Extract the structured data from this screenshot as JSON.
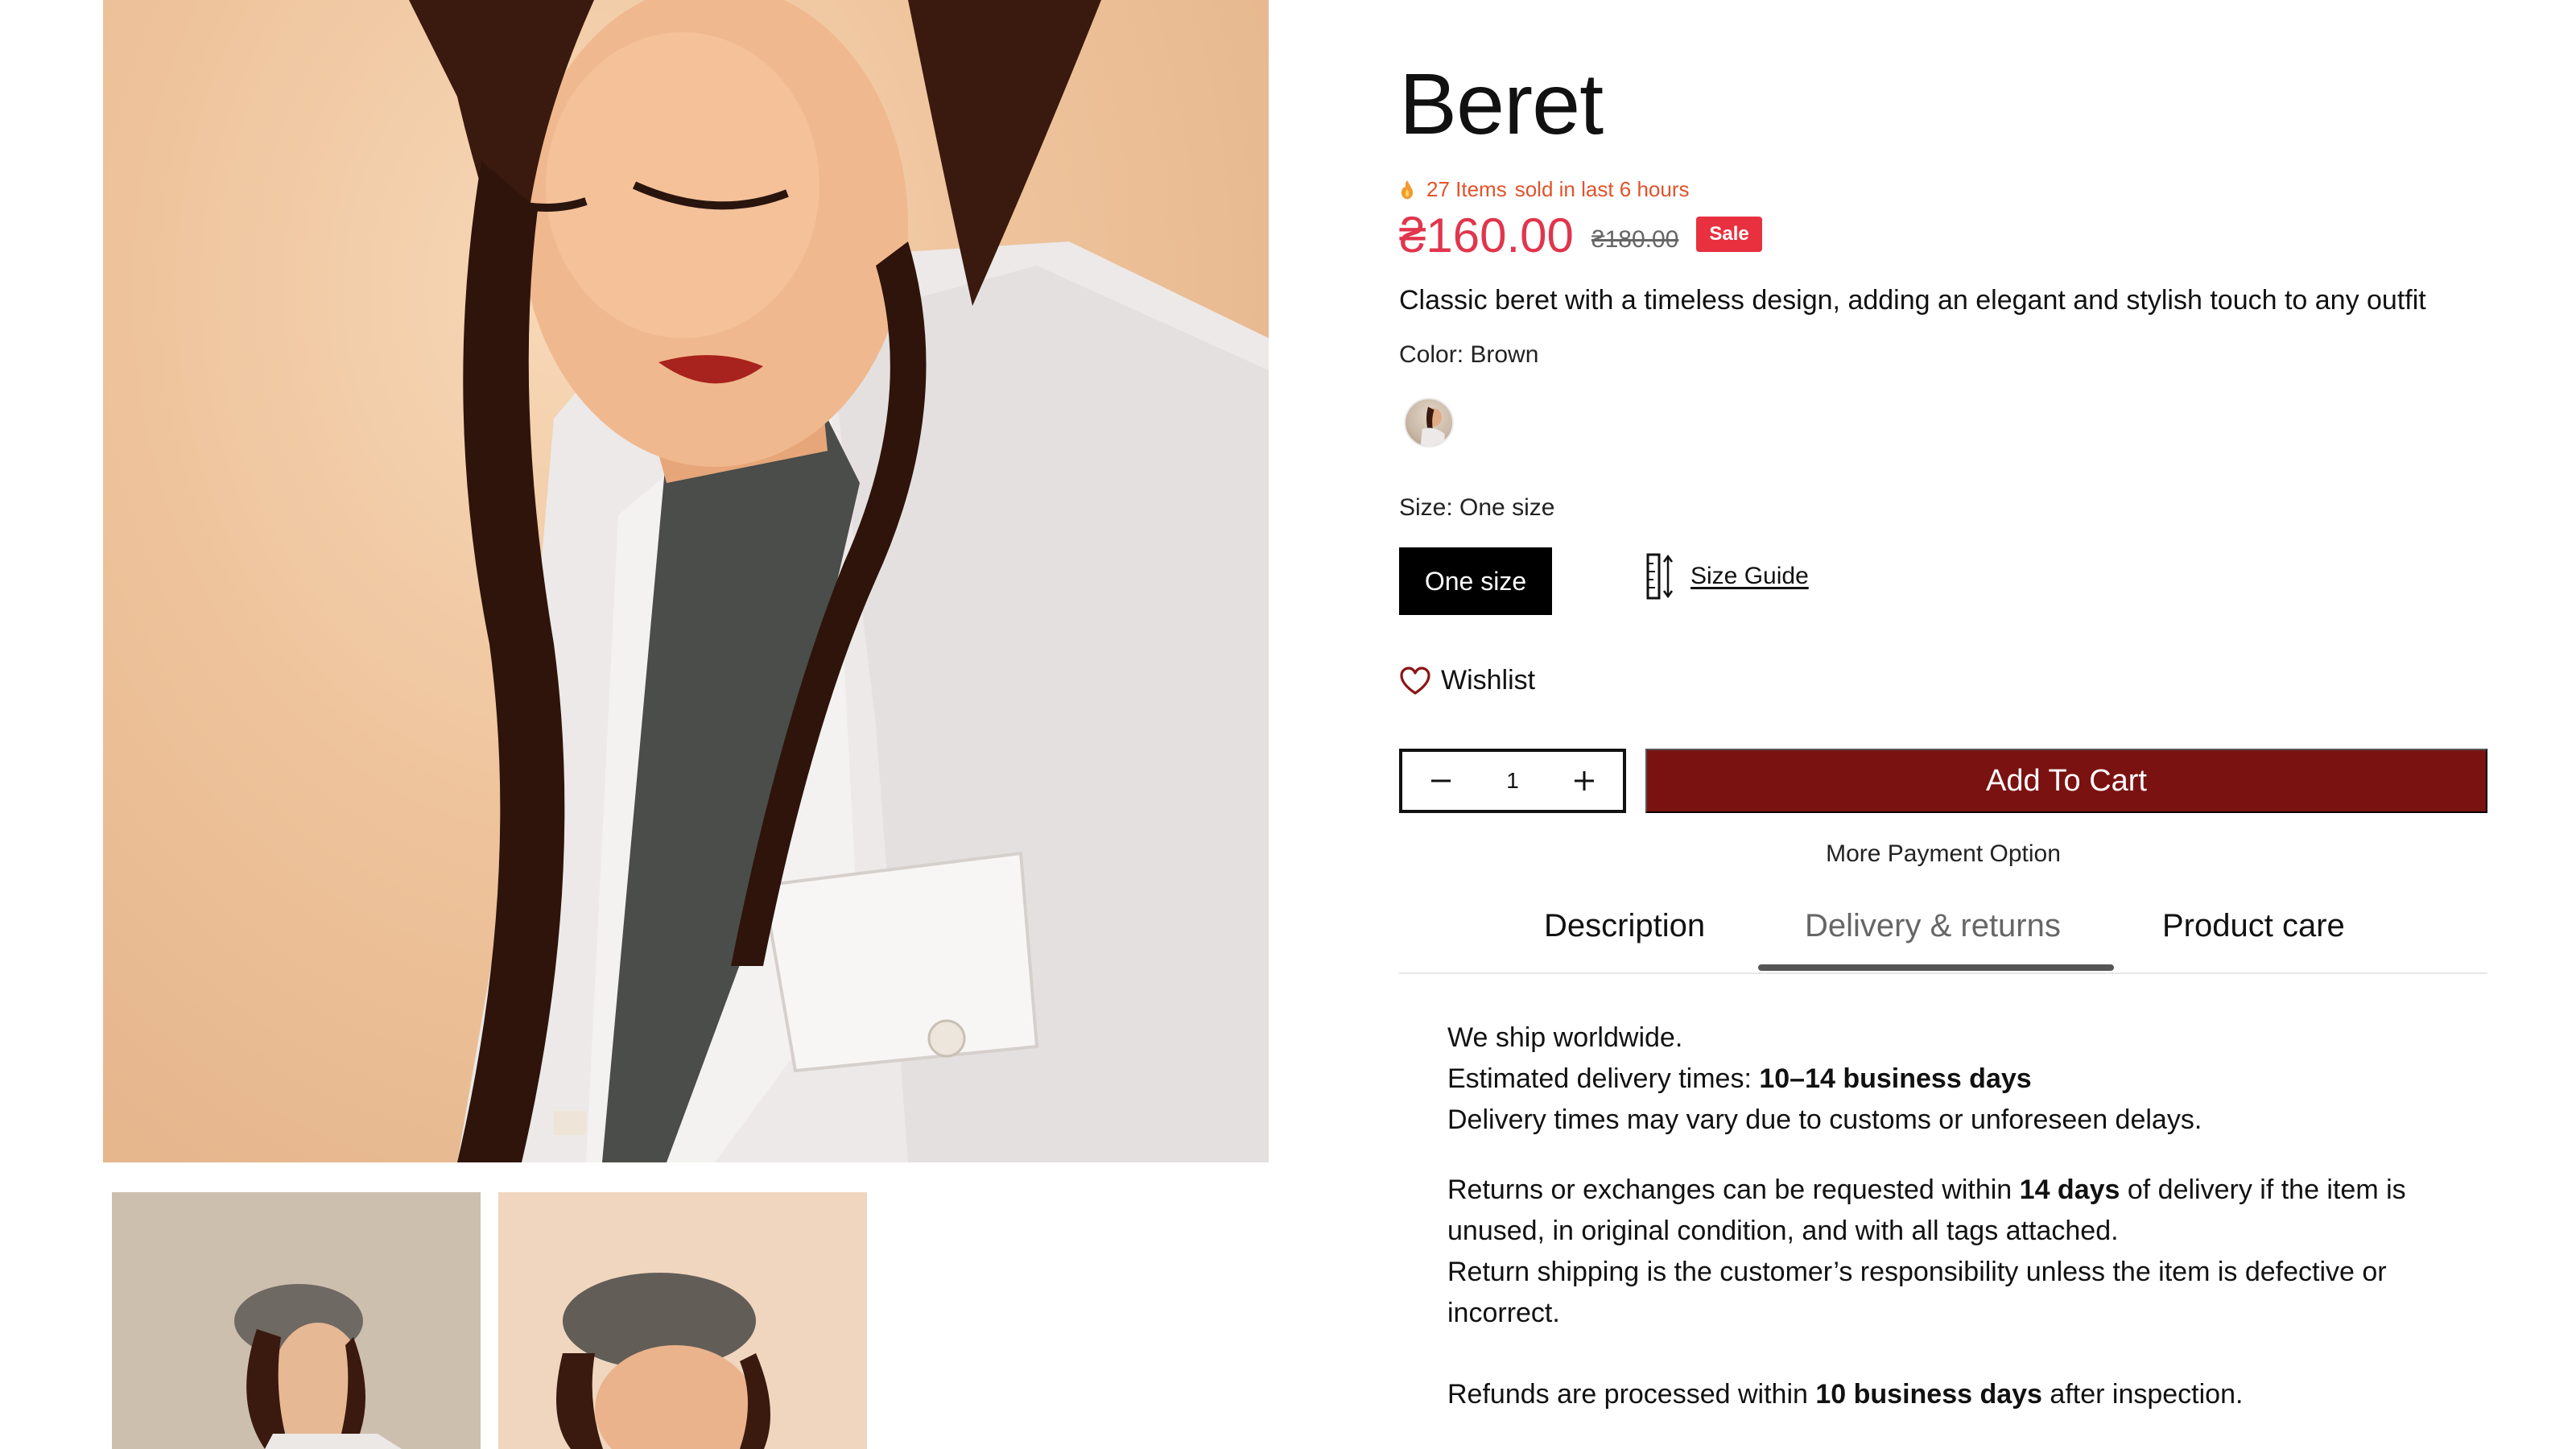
{
  "product": {
    "title": "Beret",
    "sold_count": "27 Items",
    "sold_suffix": "sold in last 6 hours",
    "price": "₴160.00",
    "compare_price": "₴180.00",
    "sale_badge": "Sale",
    "description": "Classic beret with a timeless design, adding an elegant and stylish touch to any outfit",
    "color_label": "Color: Brown",
    "size_label": "Size: One size",
    "size_option": "One size",
    "size_guide": "Size Guide",
    "wishlist": "Wishlist",
    "quantity": "1",
    "add_to_cart": "Add To Cart",
    "more_payment": "More Payment Option"
  },
  "tabs": [
    {
      "label": "Description"
    },
    {
      "label": "Delivery & returns"
    },
    {
      "label": "Product care"
    }
  ],
  "delivery": {
    "line1": "We ship worldwide.",
    "line2_prefix": "Estimated delivery times: ",
    "line2_bold": "10–14 business days",
    "line3": "Delivery times may vary due to customs or unforeseen delays.",
    "returns_prefix": "Returns or exchanges can be requested within ",
    "returns_bold": "14 days",
    "returns_suffix": " of delivery if the item is unused, in original condition, and with all tags attached.",
    "return_shipping": "Return shipping is the customer’s responsibility unless the item is defective or incorrect.",
    "refunds_prefix": "Refunds are processed within ",
    "refunds_bold": "10 business days",
    "refunds_suffix": " after inspection."
  },
  "icons": {
    "flame": "flame-icon",
    "ruler": "ruler-icon",
    "heart": "heart-icon",
    "minus": "minus-icon",
    "plus": "plus-icon"
  },
  "colors": {
    "accent_red": "#e0364d",
    "sale_bg": "#e8303f",
    "cart_bg": "#7b1212",
    "sold_text": "#e0532b"
  }
}
